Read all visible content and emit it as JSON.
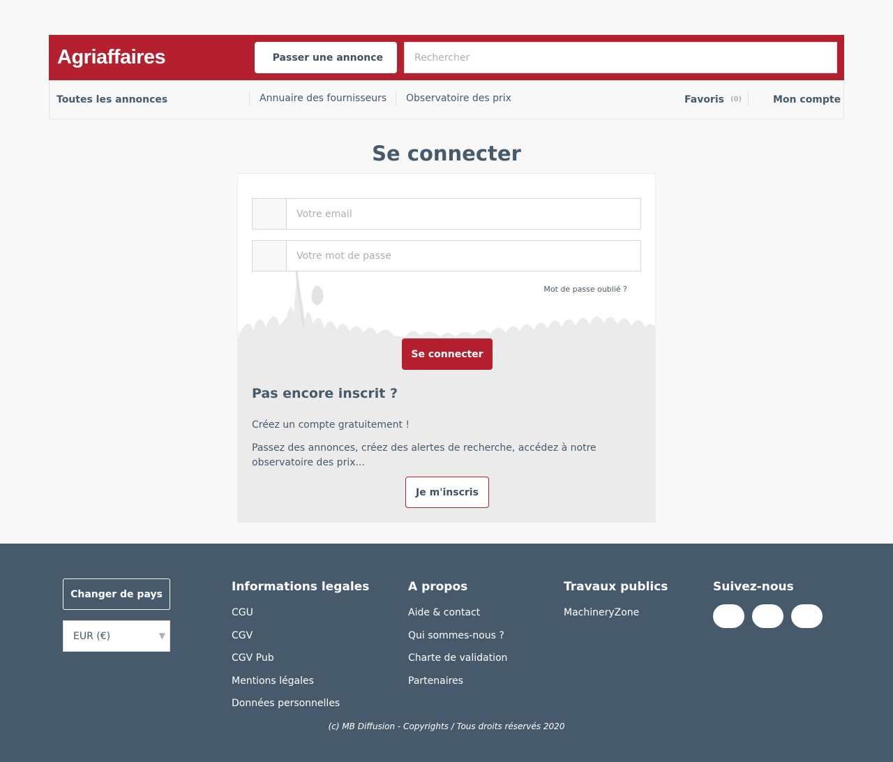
{
  "header": {
    "logo": "Agriaffaires",
    "post_ad_label": "Passer une annonce",
    "search_placeholder": "Rechercher"
  },
  "nav": {
    "all_ads": "Toutes les annonces",
    "suppliers": "Annuaire des fournisseurs",
    "price_observatory": "Observatoire des prix",
    "favorites_label": "Favoris",
    "favorites_count": "(0)",
    "account": "Mon compte"
  },
  "login": {
    "title": "Se connecter",
    "email_placeholder": "Votre email",
    "password_placeholder": "Votre mot de passe",
    "forgot_password": "Mot de passe oublié ?",
    "submit_label": "Se connecter"
  },
  "register": {
    "heading": "Pas encore inscrit ?",
    "create_text": "Créez un compte gratuitement !",
    "description": "Passez des annonces, créez des alertes de recherche, accédez à notre observatoire des prix...",
    "button_label": "Je m'inscris"
  },
  "footer": {
    "change_country": "Changer de pays",
    "currency": "EUR (€)",
    "columns": [
      {
        "heading": "Informations legales",
        "links": [
          "CGU",
          "CGV",
          "CGV Pub",
          "Mentions légales",
          "Données personnelles"
        ]
      },
      {
        "heading": "A propos",
        "links": [
          "Aide & contact",
          "Qui sommes-nous ?",
          "Charte de validation",
          "Partenaires"
        ]
      },
      {
        "heading": "Travaux publics",
        "links": [
          "MachineryZone"
        ]
      },
      {
        "heading": "Suivez-nous",
        "links": []
      }
    ],
    "social_icons": [
      "facebook-icon",
      "twitter-icon",
      "youtube-icon"
    ],
    "copyright": "(c) MB Diffusion - Copyrights / Tous droits réservés 2020"
  },
  "colors": {
    "brand_red": "#b5202e",
    "slate": "#465a6b",
    "page_bg": "#f8f8f8"
  }
}
